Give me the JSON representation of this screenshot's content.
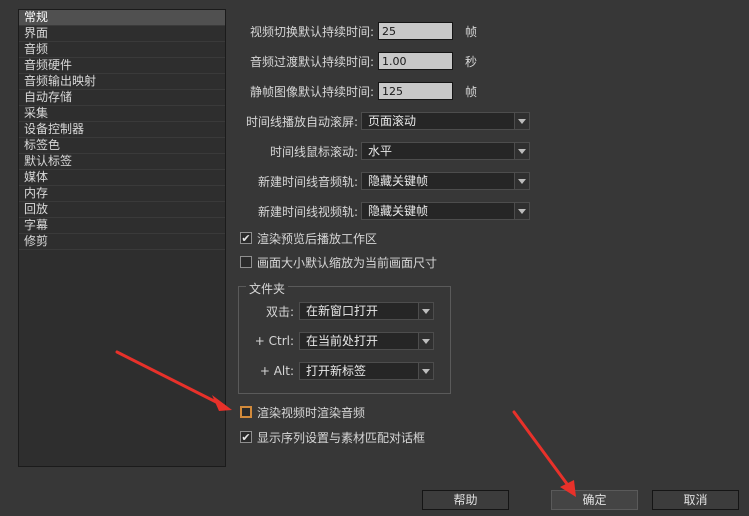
{
  "sidebar": {
    "items": [
      "常规",
      "界面",
      "音频",
      "音频硬件",
      "音频输出映射",
      "自动存储",
      "采集",
      "设备控制器",
      "标签色",
      "默认标签",
      "媒体",
      "内存",
      "回放",
      "字幕",
      "修剪"
    ],
    "selected_index": 0
  },
  "general": {
    "video_transition": {
      "label": "视频切换默认持续时间:",
      "value": "25",
      "unit": "帧"
    },
    "audio_transition": {
      "label": "音频过渡默认持续时间:",
      "value": "1.00",
      "unit": "秒"
    },
    "still_image": {
      "label": "静帧图像默认持续时间:",
      "value": "125",
      "unit": "帧"
    },
    "timeline_autoscroll": {
      "label": "时间线播放自动滚屏:",
      "value": "页面滚动"
    },
    "timeline_mouse_scroll": {
      "label": "时间线鼠标滚动:",
      "value": "水平"
    },
    "new_audio_tracks": {
      "label": "新建时间线音频轨:",
      "value": "隐藏关键帧"
    },
    "new_video_tracks": {
      "label": "新建时间线视频轨:",
      "value": "隐藏关键帧"
    },
    "play_work_area": {
      "label": "渲染预览后播放工作区",
      "checked": true
    },
    "default_scale": {
      "label": "画面大小默认缩放为当前画面尺寸",
      "checked": false
    }
  },
  "bins": {
    "title": "文件夹",
    "double_click": {
      "label": "双击:",
      "value": "在新窗口打开"
    },
    "ctrl": {
      "label": "+ Ctrl:",
      "value": "在当前处打开"
    },
    "alt": {
      "label": "+ Alt:",
      "value": "打开新标签"
    }
  },
  "render_audio": {
    "label": "渲染视频时渲染音频",
    "checked": false
  },
  "show_sequence_dialog": {
    "label": "显示序列设置与素材匹配对话框",
    "checked": true
  },
  "buttons": {
    "help": "帮助",
    "ok": "确定",
    "cancel": "取消"
  },
  "colors": {
    "annotation_arrow": "#e8312a",
    "highlight_border": "#d28a3b"
  },
  "check_glyph": "✔"
}
